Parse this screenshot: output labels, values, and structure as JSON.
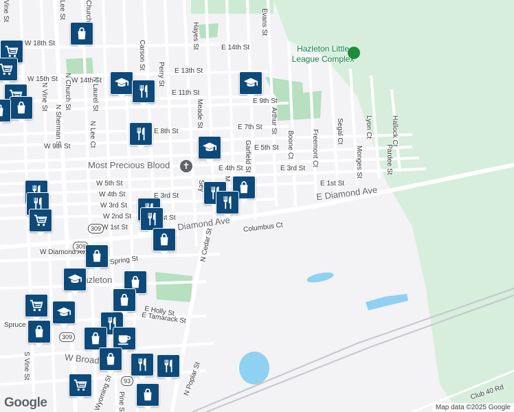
{
  "colors": {
    "land": "#f3f2f5",
    "road": "#ffffff",
    "park": "#cdebd4",
    "park_dark": "#b6e0c0",
    "water": "#8fd1f0",
    "rail": "#c5c5cc",
    "pin_bg": "#0d4a7a",
    "landmark_icon": "#1e8e3e",
    "school_icon": "#5f6368"
  },
  "street_labels": [
    {
      "text": "Vine St"
    },
    {
      "text": "Church St"
    },
    {
      "text": "Evans St"
    },
    {
      "text": "W 18th St"
    },
    {
      "text": "E 14th St"
    },
    {
      "text": "Carson St"
    },
    {
      "text": "Hayes St"
    },
    {
      "text": "Perry St"
    },
    {
      "text": "E 13th St"
    },
    {
      "text": "W 15th St"
    },
    {
      "text": "W 14th St"
    },
    {
      "text": "N Vine St"
    },
    {
      "text": "N Church St"
    },
    {
      "text": "N Laurel St"
    },
    {
      "text": "E 11th St"
    },
    {
      "text": "N Sherman St"
    },
    {
      "text": "Meade St"
    },
    {
      "text": "E 9th St"
    },
    {
      "text": "Arthur St"
    },
    {
      "text": "Boone Ct"
    },
    {
      "text": "Freemont Ct"
    },
    {
      "text": "Segal Ct"
    },
    {
      "text": "Lyon Ct"
    },
    {
      "text": "Hallock Ct"
    },
    {
      "text": "N Lee Ct"
    },
    {
      "text": "W 9th St"
    },
    {
      "text": "E 8th St"
    },
    {
      "text": "E 7th St"
    },
    {
      "text": "E 5th St"
    },
    {
      "text": "Garfield St"
    },
    {
      "text": "Monges St"
    },
    {
      "text": "Pardee St"
    },
    {
      "text": "W 5th St"
    },
    {
      "text": "E 4th St"
    },
    {
      "text": "E 3rd St"
    },
    {
      "text": "W 4th St"
    },
    {
      "text": "W 3rd St"
    },
    {
      "text": "E 1st St"
    },
    {
      "text": "W 2nd St"
    },
    {
      "text": "W 1st St"
    },
    {
      "text": "E Diamond Ave"
    },
    {
      "text": "Diamond Ave"
    },
    {
      "text": "Columbus Ct"
    },
    {
      "text": "N Cedar St"
    },
    {
      "text": "W Diamond Ave"
    },
    {
      "text": "Spring St"
    },
    {
      "text": "E Holly St"
    },
    {
      "text": "E Tamarack St"
    },
    {
      "text": "Spruce"
    },
    {
      "text": "S Vine St"
    },
    {
      "text": "W Broad St"
    },
    {
      "text": "N Poplar St"
    },
    {
      "text": "Pine St"
    },
    {
      "text": "Wyoming St"
    },
    {
      "text": "Club 40 Rd"
    },
    {
      "text": "Lee St"
    },
    {
      "text": "Sey"
    },
    {
      "text": "E 3rd St"
    },
    {
      "text": "1st St"
    },
    {
      "text": "M"
    }
  ],
  "places": {
    "park_label": "Hazleton Little League Complex",
    "church_label": "Most Precious Blood",
    "city_label": "Hazleton"
  },
  "shields": [
    "309",
    "309",
    "309",
    "93"
  ],
  "pins": [
    {
      "icon": "bag"
    },
    {
      "icon": "cart"
    },
    {
      "icon": "cart"
    },
    {
      "icon": "school"
    },
    {
      "icon": "dining"
    },
    {
      "icon": "school"
    },
    {
      "icon": "cart"
    },
    {
      "icon": "bag"
    },
    {
      "icon": "bag"
    },
    {
      "icon": "dining"
    },
    {
      "icon": "school"
    },
    {
      "icon": "dining"
    },
    {
      "icon": "bag"
    },
    {
      "icon": "dining"
    },
    {
      "icon": "dining"
    },
    {
      "icon": "dining"
    },
    {
      "icon": "cart"
    },
    {
      "icon": "dining"
    },
    {
      "icon": "dining"
    },
    {
      "icon": "bag"
    },
    {
      "icon": "bag"
    },
    {
      "icon": "school"
    },
    {
      "icon": "bag"
    },
    {
      "icon": "cart"
    },
    {
      "icon": "school"
    },
    {
      "icon": "bag"
    },
    {
      "icon": "dining"
    },
    {
      "icon": "coffee"
    },
    {
      "icon": "bag"
    },
    {
      "icon": "bag"
    },
    {
      "icon": "dining"
    },
    {
      "icon": "dining"
    },
    {
      "icon": "cart"
    },
    {
      "icon": "bag"
    },
    {
      "icon": "bag"
    }
  ],
  "attribution": {
    "logo": "Google",
    "map_data": "Map data ©2025 Google"
  }
}
